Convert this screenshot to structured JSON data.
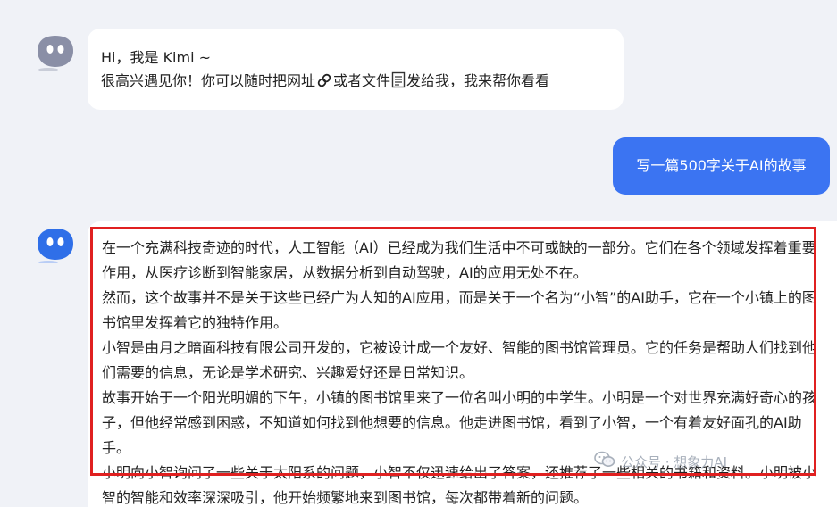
{
  "colors": {
    "page_bg": "#f0f2f7",
    "user_bubble": "#3b74f2",
    "highlight_border": "#e02020",
    "avatar": "#8a8fa6",
    "avatar_active": "#2f6fe8"
  },
  "assistant_greeting": {
    "line1": "Hi，我是 Kimi ~",
    "line2_part1": "很高兴遇见你！你可以随时把网址",
    "link_icon": "link-icon",
    "line2_part2": "或者文件",
    "file_icon": "file-icon",
    "line2_part3": "发给我，我来帮你看看"
  },
  "user_message": {
    "text": "写一篇500字关于AI的故事"
  },
  "assistant_answer": {
    "paragraphs": [
      "在一个充满科技奇迹的时代，人工智能（AI）已经成为我们生活中不可或缺的一部分。它们在各个领域发挥着重要作用，从医疗诊断到智能家居，从数据分析到自动驾驶，AI的应用无处不在。",
      "然而，这个故事并不是关于这些已经广为人知的AI应用，而是关于一个名为“小智”的AI助手，它在一个小镇上的图书馆里发挥着它的独特作用。",
      "小智是由月之暗面科技有限公司开发的，它被设计成一个友好、智能的图书馆管理员。它的任务是帮助人们找到他们需要的信息，无论是学术研究、兴趣爱好还是日常知识。",
      "故事开始于一个阳光明媚的下午，小镇的图书馆里来了一位名叫小明的中学生。小明是一个对世界充满好奇心的孩子，但他经常感到困惑，不知道如何找到他想要的信息。他走进图书馆，看到了小智，一个有着友好面孔的AI助手。",
      "小明向小智询问了一些关于太阳系的问题，小智不仅迅速给出了答案，还推荐了一些相关的书籍和资料。小明被小智的智能和效率深深吸引，他开始频繁地来到图书馆，每次都带着新的问题。"
    ]
  },
  "watermark": {
    "icon": "wechat-icon",
    "text": "公众号 · 想象力AI"
  }
}
